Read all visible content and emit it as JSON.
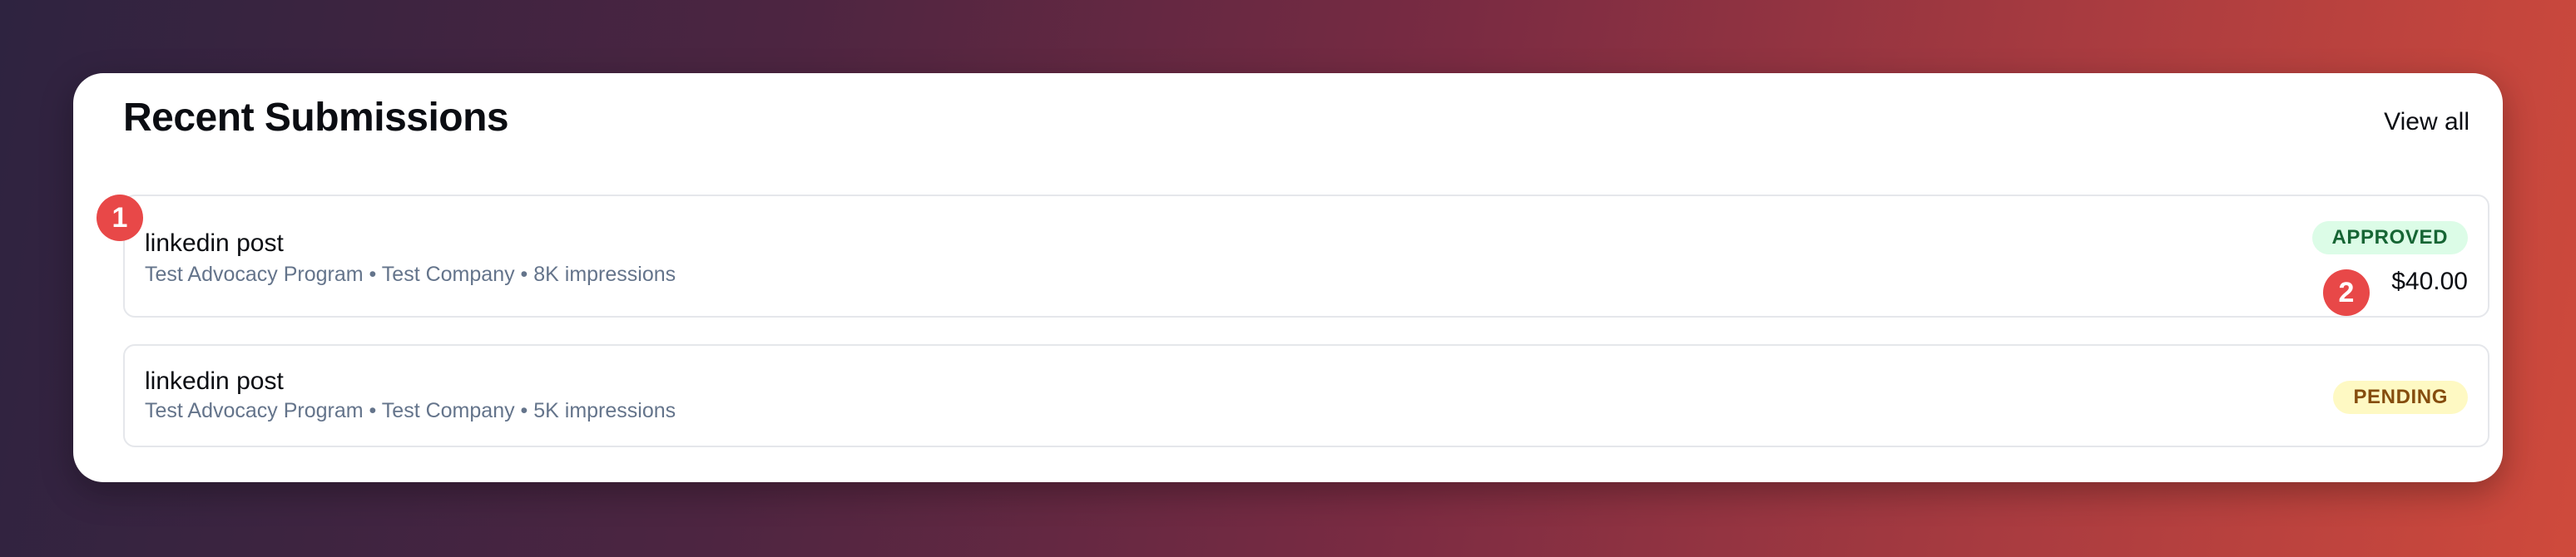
{
  "card": {
    "title": "Recent Submissions",
    "view_all_label": "View all"
  },
  "submissions": [
    {
      "title": "linkedin post",
      "program": "Test Advocacy Program",
      "company": "Test Company",
      "impressions": "8K impressions",
      "meta": "Test Advocacy Program • Test Company • 8K impressions",
      "status": "APPROVED",
      "amount": "$40.00"
    },
    {
      "title": "linkedin post",
      "program": "Test Advocacy Program",
      "company": "Test Company",
      "impressions": "5K impressions",
      "meta": "Test Advocacy Program • Test Company • 5K impressions",
      "status": "PENDING"
    }
  ],
  "markers": [
    "1",
    "2"
  ],
  "colors": {
    "approved_bg": "#dcfce7",
    "approved_text": "#166534",
    "pending_bg": "#fef9c3",
    "pending_text": "#854d0e",
    "marker": "#e84848"
  }
}
